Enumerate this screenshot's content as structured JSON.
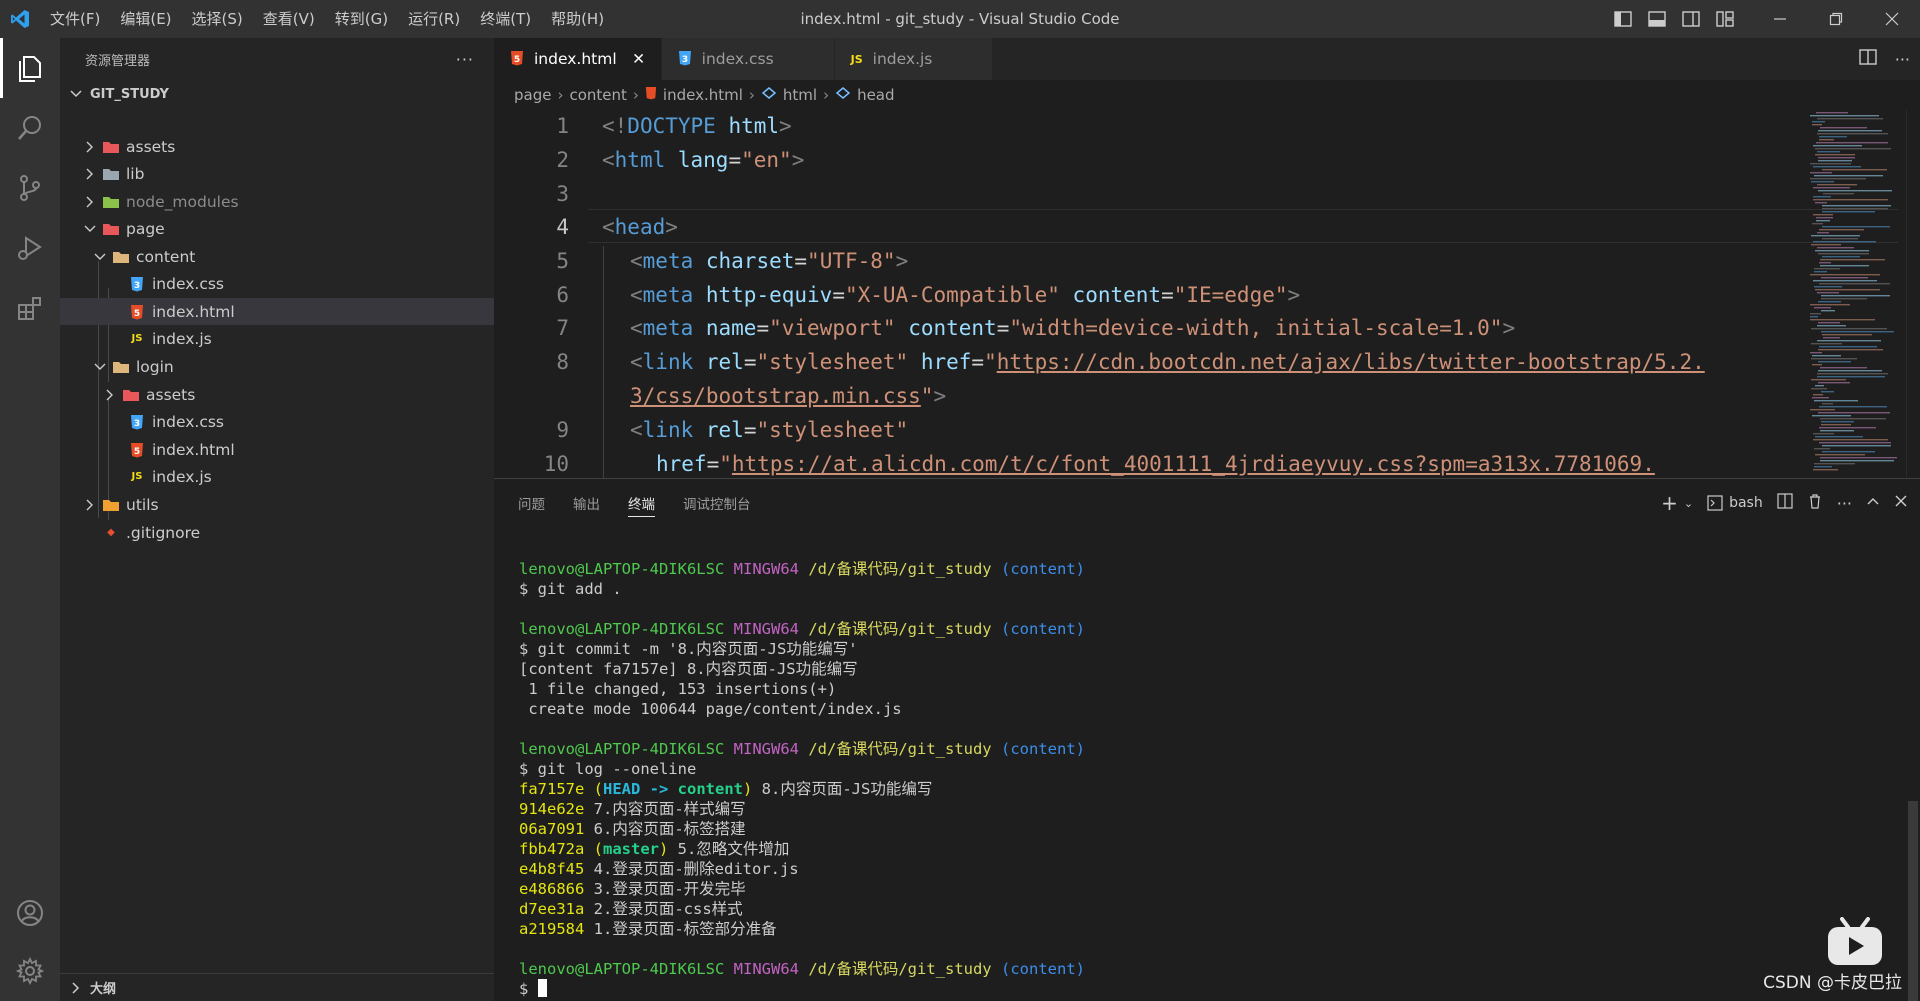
{
  "window": {
    "title": "index.html - git_study - Visual Studio Code",
    "menu": [
      "文件(F)",
      "编辑(E)",
      "选择(S)",
      "查看(V)",
      "转到(G)",
      "运行(R)",
      "终端(T)",
      "帮助(H)"
    ]
  },
  "sidebar": {
    "title": "资源管理器",
    "more": "···",
    "root": "GIT_STUDY",
    "outline": "大纲",
    "tree": [
      {
        "label": "assets",
        "icon": "assets-folder-icon",
        "color": "#e8575a"
      },
      {
        "label": "lib",
        "icon": "lib-folder-icon",
        "color": "#9aa7b0"
      },
      {
        "label": "node_modules",
        "icon": "node-folder-icon",
        "color": "#8bc34a"
      },
      {
        "label": "page",
        "icon": "page-folder-icon",
        "color": "#e8575a"
      },
      {
        "label": "content",
        "icon": "folder-icon",
        "color": "#dcb67a"
      },
      {
        "label": "index.css",
        "icon": "css-file-icon",
        "color": "#42a5f5"
      },
      {
        "label": "index.html",
        "icon": "html-file-icon",
        "color": "#e44d26"
      },
      {
        "label": "index.js",
        "icon": "js-file-icon",
        "color": "#f5de19"
      },
      {
        "label": "login",
        "icon": "folder-icon",
        "color": "#dcb67a"
      },
      {
        "label": "assets",
        "icon": "assets-folder-icon",
        "color": "#e8575a"
      },
      {
        "label": "index.css",
        "icon": "css-file-icon",
        "color": "#42a5f5"
      },
      {
        "label": "index.html",
        "icon": "html-file-icon",
        "color": "#e44d26"
      },
      {
        "label": "index.js",
        "icon": "js-file-icon",
        "color": "#f5de19"
      },
      {
        "label": "utils",
        "icon": "utils-folder-icon",
        "color": "#f0a030"
      },
      {
        "label": ".gitignore",
        "icon": "git-file-icon",
        "color": "#e84e31"
      }
    ]
  },
  "tabs": [
    {
      "label": "index.html",
      "icon_text": "5",
      "close": "✕"
    },
    {
      "label": "index.css",
      "icon_text": "3"
    },
    {
      "label": "index.js",
      "icon_text": "JS"
    }
  ],
  "breadcrumb": [
    "page",
    "content",
    "index.html",
    "html",
    "head"
  ],
  "editor": {
    "line_numbers": [
      "1",
      "2",
      "3",
      "4",
      "5",
      "6",
      "7",
      "8",
      "9",
      "10"
    ],
    "lines": {
      "l1": {
        "a": "<!",
        "b": "DOCTYPE",
        "c": " html",
        "d": ">"
      },
      "l2": {
        "a": "<",
        "b": "html",
        "c": " lang",
        "d": "=",
        "e": "\"en\"",
        "f": ">"
      },
      "l4": {
        "a": "<",
        "b": "head",
        "c": ">"
      },
      "l5": {
        "a": "<",
        "b": "meta",
        "c": " charset",
        "d": "=",
        "e": "\"UTF-8\"",
        "f": ">"
      },
      "l6": {
        "a": "<",
        "b": "meta",
        "c": " http-equiv",
        "d": "=",
        "e": "\"X-UA-Compatible\"",
        "g": " content",
        "h": "=",
        "i": "\"IE=edge\"",
        "f": ">"
      },
      "l7": {
        "a": "<",
        "b": "meta",
        "c": " name",
        "d": "=",
        "e": "\"viewport\"",
        "g": " content",
        "h": "=",
        "i": "\"width=device-width, initial-scale=1.0\"",
        "f": ">"
      },
      "l8": {
        "a": "<",
        "b": "link",
        "c": " rel",
        "d": "=",
        "e": "\"stylesheet\"",
        "g": " href",
        "h": "=",
        "q": "\"",
        "u": "https://cdn.bootcdn.net/ajax/libs/twitter-bootstrap/5.2.",
        "u2": "3/css/bootstrap.min.css",
        "q2": "\"",
        "f": ">"
      },
      "l9": {
        "a": "<",
        "b": "link",
        "c": " rel",
        "d": "=",
        "e": "\"stylesheet\""
      },
      "l10": {
        "c": "href",
        "d": "=",
        "q": "\"",
        "u": "https://at.alicdn.com/t/c/font_4001111_4jrdiaeyvuy.css?spm=a313x.7781069."
      }
    }
  },
  "panel": {
    "tabs": [
      "问题",
      "输出",
      "终端",
      "调试控制台"
    ],
    "shell": "bash",
    "terminal": {
      "prompt_user": "lenovo@LAPTOP-4DIK6LSC",
      "prompt_sys": "MINGW64",
      "prompt_path": "/d/备课代码/git_study",
      "prompt_branch": "(content)",
      "cmd1": "$ git add .",
      "cmd2": "$ git commit -m '8.内容页面-JS功能编写'",
      "out2a": "[content fa7157e] 8.内容页面-JS功能编写",
      "out2b": " 1 file changed, 153 insertions(+)",
      "out2c": " create mode 100644 page/content/index.js",
      "cmd3": "$ git log --oneline",
      "log": [
        {
          "hash": "fa7157e",
          "open": " (",
          "head": "HEAD -> ",
          "branch": "content",
          "close": ")",
          "msg": " 8.内容页面-JS功能编写"
        },
        {
          "hash": "914e62e",
          "msg": " 7.内容页面-样式编写"
        },
        {
          "hash": "06a7091",
          "msg": " 6.内容页面-标签搭建"
        },
        {
          "hash": "fbb472a",
          "open": " (",
          "branch": "master",
          "close": ")",
          "msg": " 5.忽略文件增加"
        },
        {
          "hash": "e4b8f45",
          "msg": " 4.登录页面-删除editor.js"
        },
        {
          "hash": "e486866",
          "msg": " 3.登录页面-开发完毕"
        },
        {
          "hash": "d7ee31a",
          "msg": " 2.登录页面-css样式"
        },
        {
          "hash": "a219584",
          "msg": " 1.登录页面-标签部分准备"
        }
      ],
      "dollar": "$ "
    }
  },
  "watermark": "CSDN @卡皮巴拉",
  "colors": {
    "accent": "#007acc",
    "html": "#e44d26",
    "css": "#42a5f5",
    "js": "#f5de19"
  }
}
